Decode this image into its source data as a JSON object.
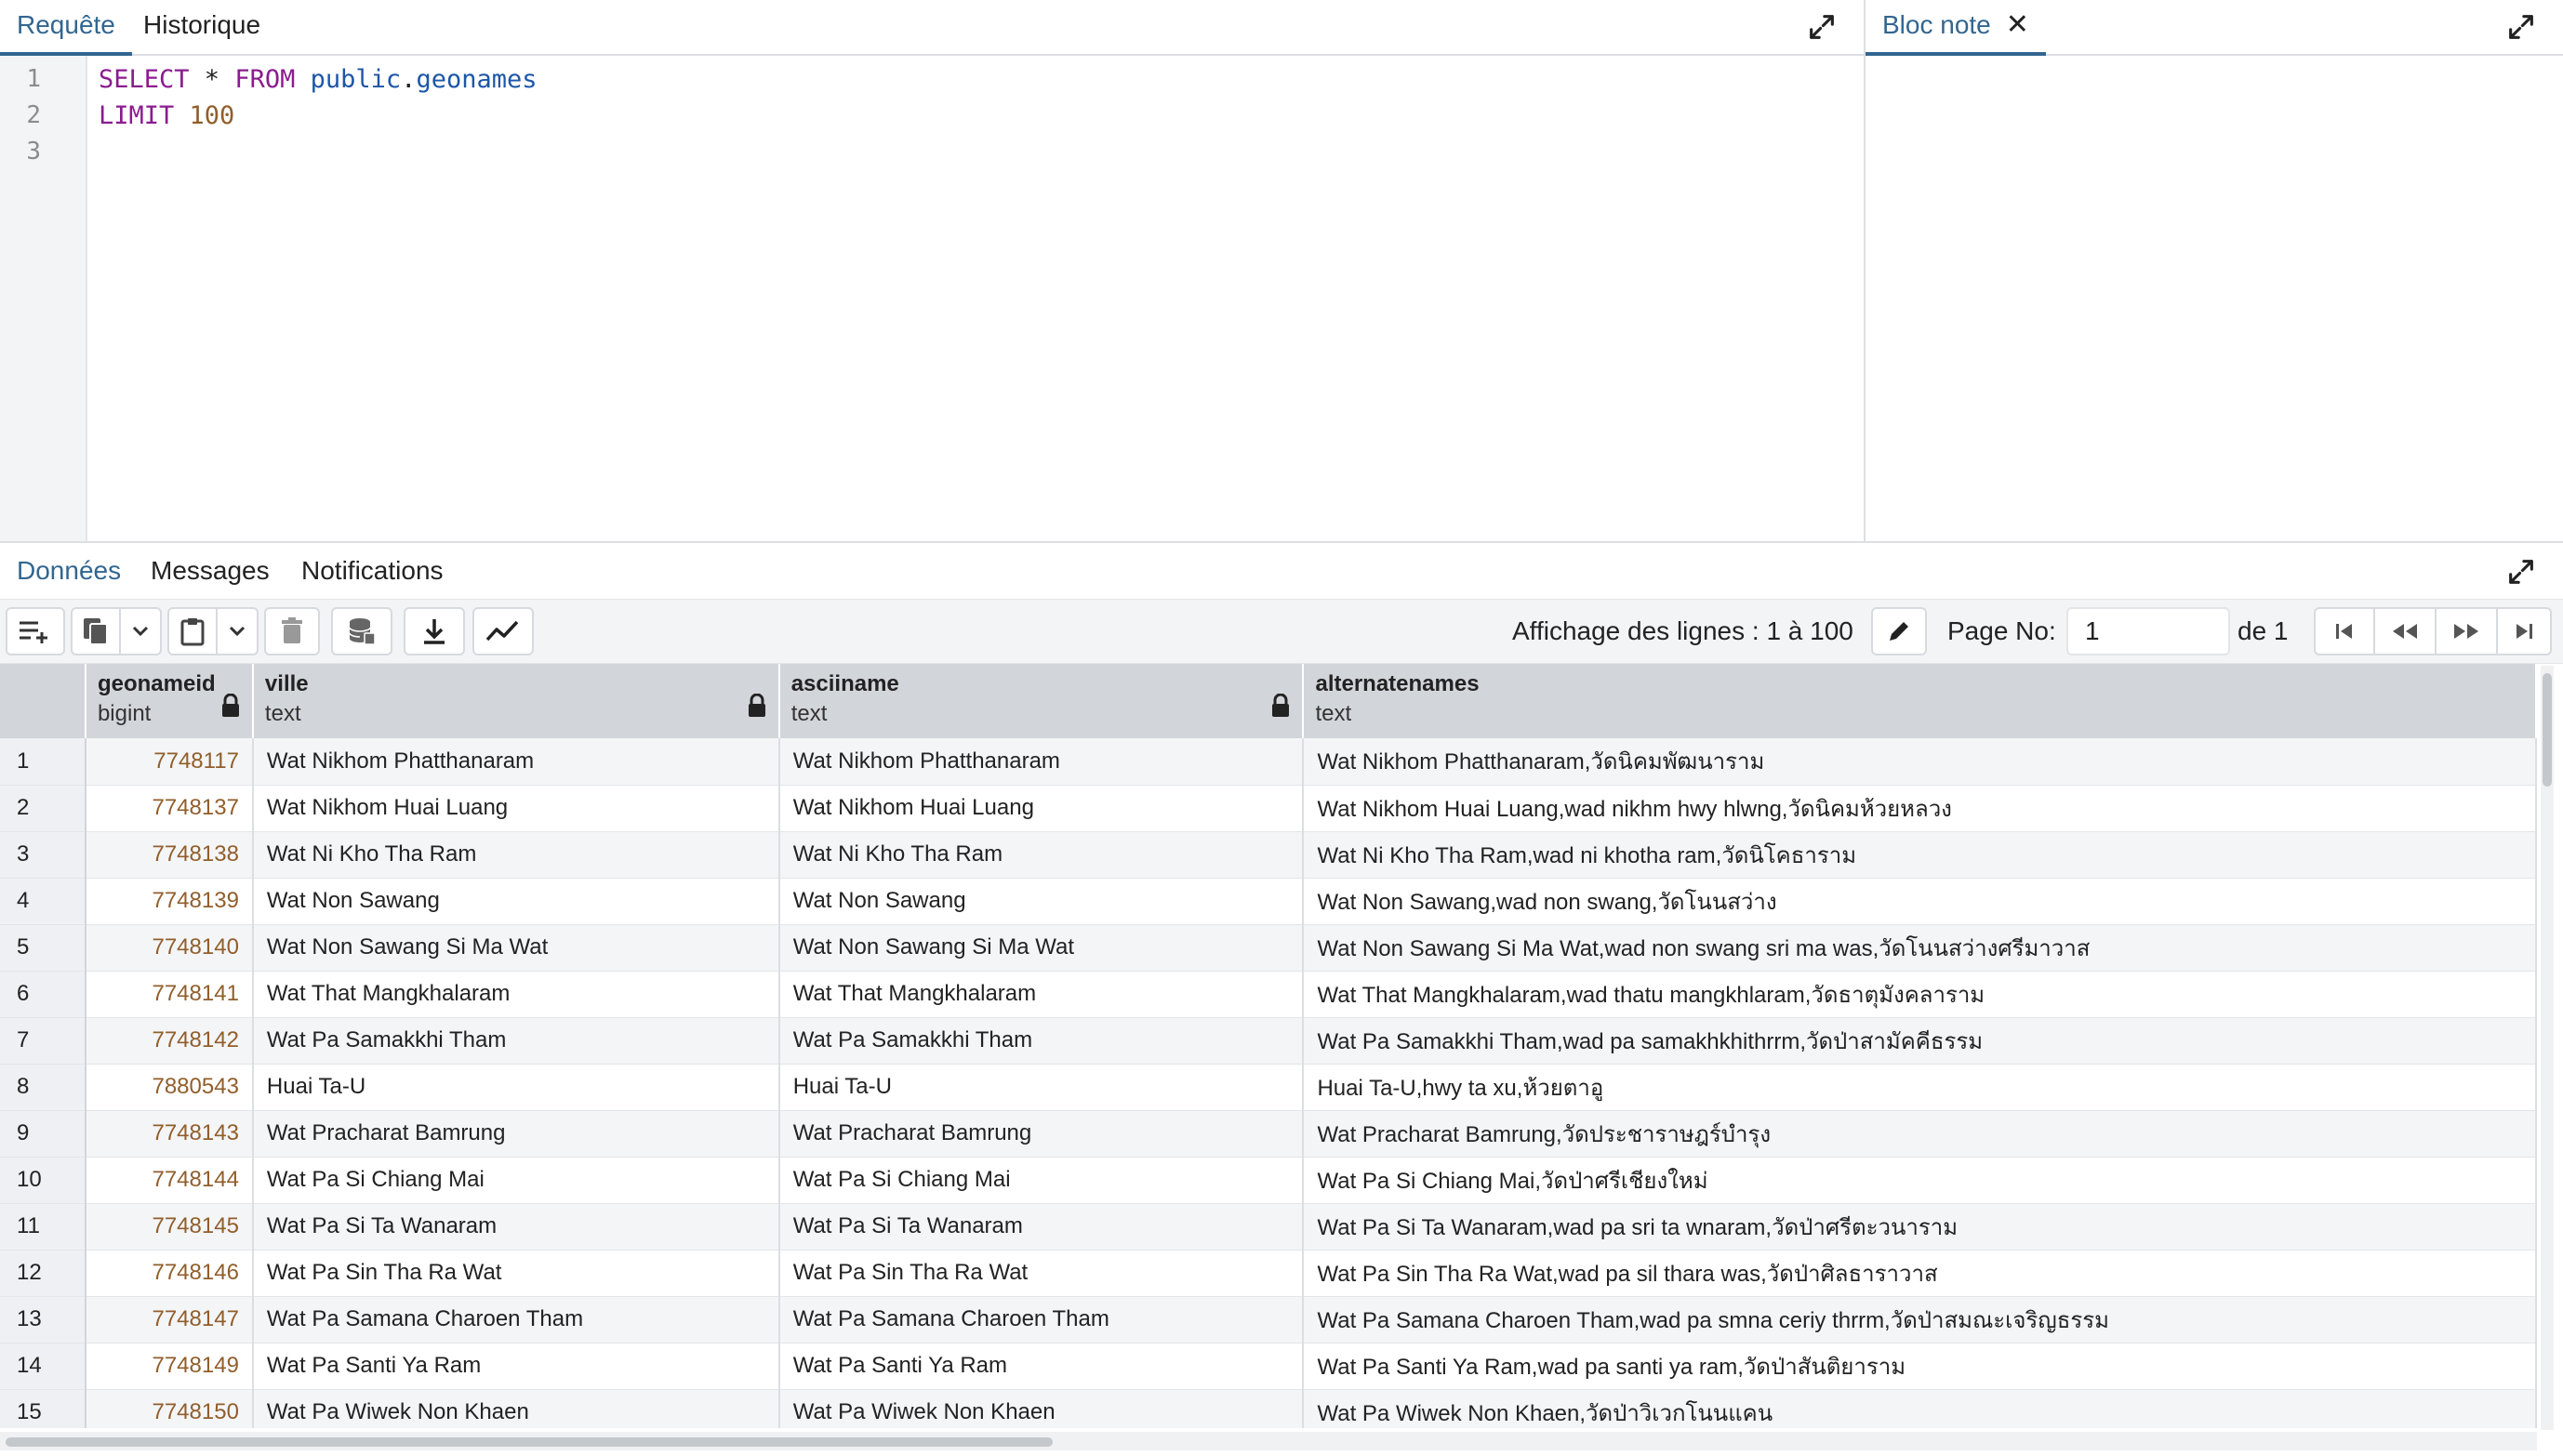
{
  "query_panel": {
    "tabs": [
      {
        "label": "Requête"
      },
      {
        "label": "Historique"
      }
    ],
    "line_numbers": [
      "1",
      "2",
      "3"
    ],
    "code": {
      "line1": {
        "kw_select": "SELECT",
        "star": " * ",
        "kw_from": "FROM",
        "space": " ",
        "schema": "public",
        "dot": ".",
        "table": "geonames"
      },
      "line2": {
        "kw_limit": "LIMIT",
        "space": " ",
        "value": "100"
      }
    }
  },
  "notes_panel": {
    "tab_label": "Bloc note"
  },
  "results_panel": {
    "tabs": [
      {
        "label": "Données"
      },
      {
        "label": "Messages"
      },
      {
        "label": "Notifications"
      }
    ],
    "row_info": "Affichage des lignes : 1 à 100",
    "page_label": "Page No:",
    "page_value": "1",
    "page_of": "de 1"
  },
  "grid": {
    "columns": [
      {
        "name": "geonameid",
        "type": "bigint"
      },
      {
        "name": "ville",
        "type": "text"
      },
      {
        "name": "asciiname",
        "type": "text"
      },
      {
        "name": "alternatenames",
        "type": "text"
      }
    ],
    "rows": [
      {
        "n": "1",
        "id": "7748117",
        "ville": "Wat Nikhom Phatthanaram",
        "ascii": "Wat Nikhom Phatthanaram",
        "alt": "Wat Nikhom Phatthanaram,วัดนิคมพัฒนาราม"
      },
      {
        "n": "2",
        "id": "7748137",
        "ville": "Wat Nikhom Huai Luang",
        "ascii": "Wat Nikhom Huai Luang",
        "alt": "Wat Nikhom Huai Luang,wad nikhm hwy hlwng,วัดนิคมห้วยหลวง"
      },
      {
        "n": "3",
        "id": "7748138",
        "ville": "Wat Ni Kho Tha Ram",
        "ascii": "Wat Ni Kho Tha Ram",
        "alt": "Wat Ni Kho Tha Ram,wad ni khotha ram,วัดนิโคธาราม"
      },
      {
        "n": "4",
        "id": "7748139",
        "ville": "Wat Non Sawang",
        "ascii": "Wat Non Sawang",
        "alt": "Wat Non Sawang,wad non swang,วัดโนนสว่าง"
      },
      {
        "n": "5",
        "id": "7748140",
        "ville": "Wat Non Sawang Si Ma Wat",
        "ascii": "Wat Non Sawang Si Ma Wat",
        "alt": "Wat Non Sawang Si Ma Wat,wad non swang sri ma was,วัดโนนสว่างศรีมาวาส"
      },
      {
        "n": "6",
        "id": "7748141",
        "ville": "Wat That Mangkhalaram",
        "ascii": "Wat That Mangkhalaram",
        "alt": "Wat That Mangkhalaram,wad thatu mangkhlaram,วัดธาตุมังคลาราม"
      },
      {
        "n": "7",
        "id": "7748142",
        "ville": "Wat Pa Samakkhi Tham",
        "ascii": "Wat Pa Samakkhi Tham",
        "alt": "Wat Pa Samakkhi Tham,wad pa samakhkhithrrm,วัดป่าสามัคคีธรรม"
      },
      {
        "n": "8",
        "id": "7880543",
        "ville": "Huai Ta-U",
        "ascii": "Huai Ta-U",
        "alt": "Huai Ta-U,hwy ta xu,ห้วยตาอู"
      },
      {
        "n": "9",
        "id": "7748143",
        "ville": "Wat Pracharat Bamrung",
        "ascii": "Wat Pracharat Bamrung",
        "alt": "Wat Pracharat Bamrung,วัดประชาราษฎร์บำรุง"
      },
      {
        "n": "10",
        "id": "7748144",
        "ville": "Wat Pa Si Chiang Mai",
        "ascii": "Wat Pa Si Chiang Mai",
        "alt": "Wat Pa Si Chiang Mai,วัดป่าศรีเชียงใหม่"
      },
      {
        "n": "11",
        "id": "7748145",
        "ville": "Wat Pa Si Ta Wanaram",
        "ascii": "Wat Pa Si Ta Wanaram",
        "alt": "Wat Pa Si Ta Wanaram,wad pa sri ta wnaram,วัดป่าศรีตะวนาราม"
      },
      {
        "n": "12",
        "id": "7748146",
        "ville": "Wat Pa Sin Tha Ra Wat",
        "ascii": "Wat Pa Sin Tha Ra Wat",
        "alt": "Wat Pa Sin Tha Ra Wat,wad pa sil thara was,วัดป่าศิลธาราวาส"
      },
      {
        "n": "13",
        "id": "7748147",
        "ville": "Wat Pa Samana Charoen Tham",
        "ascii": "Wat Pa Samana Charoen Tham",
        "alt": "Wat Pa Samana Charoen Tham,wad pa smna ceriy thrrm,วัดป่าสมณะเจริญธรรม"
      },
      {
        "n": "14",
        "id": "7748149",
        "ville": "Wat Pa Santi Ya Ram",
        "ascii": "Wat Pa Santi Ya Ram",
        "alt": "Wat Pa Santi Ya Ram,wad pa santi ya ram,วัดป่าสันติยาราม"
      },
      {
        "n": "15",
        "id": "7748150",
        "ville": "Wat Pa Wiwek Non Khaen",
        "ascii": "Wat Pa Wiwek Non Khaen",
        "alt": "Wat Pa Wiwek Non Khaen,วัดป่าวิเวกโนนแคน"
      }
    ]
  }
}
